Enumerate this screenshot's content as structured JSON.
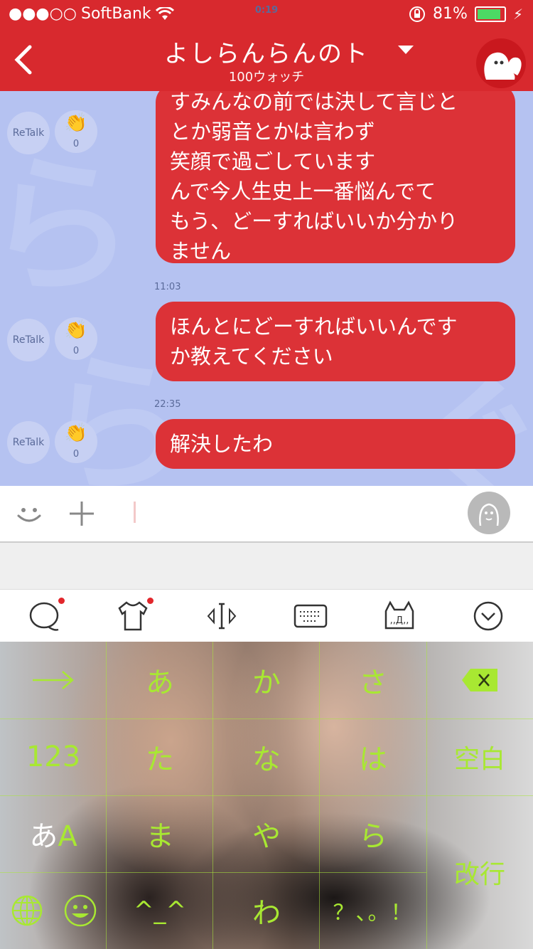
{
  "status_bar": {
    "carrier": "SoftBank",
    "time": "0:19",
    "battery": "81%",
    "battery_level": 0.81
  },
  "header": {
    "title": "よしらんらんのト",
    "subtitle": "100ウォッチ"
  },
  "messages": [
    {
      "lines": [
        "すみんなの前では決して言じと",
        "とか弱音とかは言わず",
        "笑顔で過ごしています",
        "んで今人生史上一番悩んでて",
        "もう、どーすればいいか分かり",
        "ません"
      ],
      "retalk": "ReTalk",
      "claps": "0"
    },
    {
      "time": "11:03",
      "lines": [
        "ほんとにどーすればいいんです",
        "か教えてください"
      ],
      "retalk": "ReTalk",
      "claps": "0"
    },
    {
      "time": "22:35",
      "lines": [
        "解決したわ"
      ],
      "retalk": "ReTalk",
      "claps": "0"
    }
  ],
  "keyboard": {
    "row1": [
      "→",
      "あ",
      "か",
      "さ",
      "⌫"
    ],
    "row2": [
      "123",
      "た",
      "な",
      "は",
      "空白"
    ],
    "row3": [
      "あA",
      "ま",
      "や",
      "ら",
      "改行"
    ],
    "row4": [
      "globe",
      "emoji",
      "^_^",
      "わ",
      "？、。！"
    ],
    "accent": "#a8e832"
  }
}
